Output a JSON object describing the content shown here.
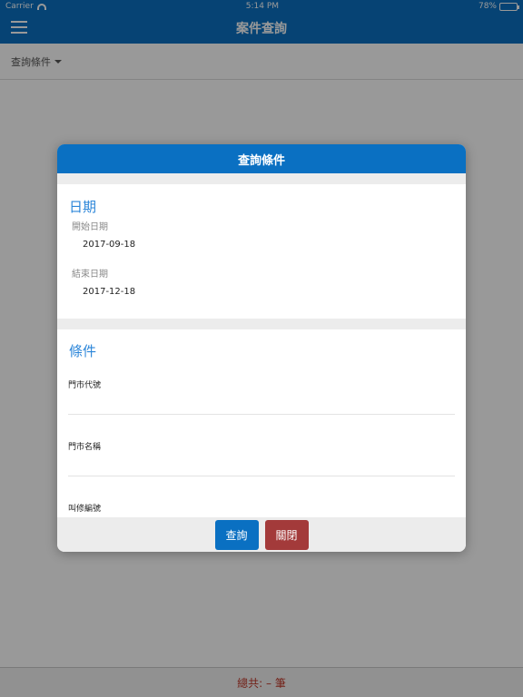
{
  "status_bar": {
    "carrier": "Carrier",
    "time": "5:14 PM",
    "battery": "78%"
  },
  "nav": {
    "title": "案件查詢",
    "menu_icon": "hamburger-menu-icon"
  },
  "filter": {
    "label": "查詢條件"
  },
  "footer": {
    "total_label": "總共: – 筆"
  },
  "modal": {
    "title": "查詢條件",
    "date_section": {
      "title": "日期",
      "start_label": "開始日期",
      "start_value": "2017-09-18",
      "end_label": "結束日期",
      "end_value": "2017-12-18"
    },
    "condition_section": {
      "title": "條件",
      "store_code_label": "門市代號",
      "store_name_label": "門市名稱",
      "repair_no_label": "叫修編號"
    },
    "buttons": {
      "query": "查詢",
      "close": "關閉"
    }
  },
  "colors": {
    "primary": "#0a70c2",
    "danger": "#a33a3a",
    "section_title": "#2c86d9"
  }
}
